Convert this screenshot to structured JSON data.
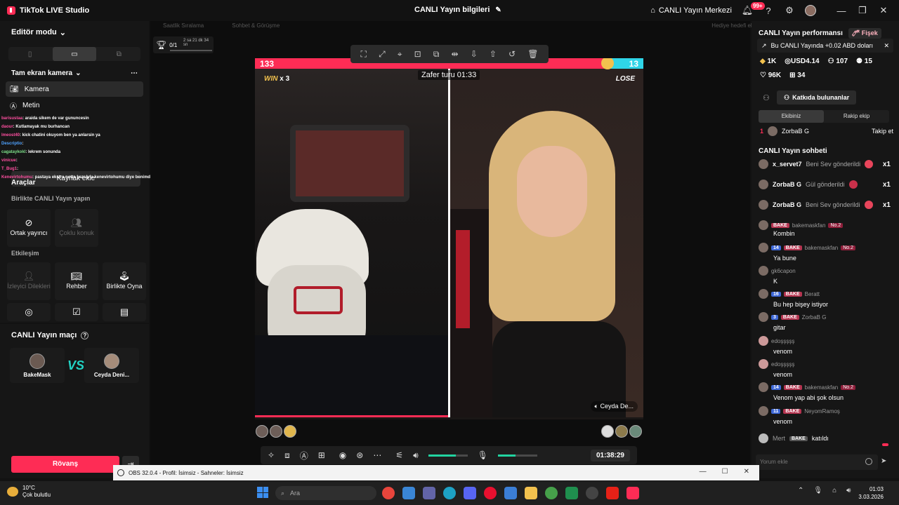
{
  "titlebar": {
    "app_name": "TikTok LIVE Studio",
    "center_title": "CANLI Yayın bilgileri",
    "center_merkez": "CANLI Yayın Merkezi",
    "notif_badge": "99+"
  },
  "left": {
    "editor_mode": "Editör modu",
    "scene_title": "Tam ekran kamera",
    "sources": [
      "Kamera",
      "Metin"
    ],
    "add_source": "Kaynak ekle",
    "tools": "Araçlar",
    "together_label": "Birlikte CANLI Yayın yapın",
    "together_tiles": [
      "Ortak yayıncı",
      "Çoklu konuk"
    ],
    "interaction_label": "Etkileşim",
    "interaction_tiles": [
      "İzleyici Dilekleri",
      "Rehber",
      "Birlikte Oyna"
    ],
    "match_title": "CANLI Yayın maçı",
    "match_player1": "BakeMask",
    "match_player2": "Ceyda Deni...",
    "vs": "VS",
    "rovans": "Rövanş",
    "overlay_chat": [
      {
        "name": "barisustaa",
        "text": ": araida sikem de var gununcesin"
      },
      {
        "name": "daour",
        "text": ": Kutlamayak mu burhancan"
      },
      {
        "name": "lmeost40",
        "text": ": kick chatini okuyom ben ya anlarsin ya"
      },
      {
        "name": "Descriptio",
        "text": ":"
      },
      {
        "name": "cagataykokl",
        "text": ": lekrem sonunda"
      },
      {
        "name": "vinicue",
        "text": ":"
      },
      {
        "name": "T_Bug1",
        "text": ":"
      },
      {
        "name": "Kenevirtohumu",
        "text": ": pastaya ekstra notta yazsana kenevirtohumu diye benimde doğum günüm"
      }
    ]
  },
  "center": {
    "top_strip": [
      "Saatlik Sıralama",
      "Sohbet & Görüşme",
      "Hediye hedefi ekle"
    ],
    "goal": {
      "count": "0/1",
      "time": "2 sa 21 dk 34 sn"
    },
    "score_left": "133",
    "score_right": "13",
    "timer": "Zafer turu 01:33",
    "win_label": "WIN",
    "win_count": "x 3",
    "lose_label": "LOSE",
    "right_name": "Ceyda De...",
    "elapsed": "01:38:29",
    "volume_level": 0.7,
    "mic_level": 0.45
  },
  "right": {
    "perf_title": "CANLI Yayın performansı",
    "fisek": "Fişek",
    "notice": "Bu CANLI Yayında +0.02 ABD doları",
    "stats1": [
      "1K",
      "USD4.14",
      "107",
      "15"
    ],
    "stats2": [
      "96K",
      "34"
    ],
    "contributors_btn": "Katkıda bulunanlar",
    "tab_ours": "Ekibiniz",
    "tab_rival": "Rakip ekip",
    "top_contrib": {
      "rank": "1",
      "name": "ZorbaB G",
      "follow": "Takip et"
    },
    "chat_title": "CANLI Yayın sohbeti",
    "gifts": [
      {
        "user": "x_servet7",
        "text": "Beni Sev gönderildi",
        "count": "x1"
      },
      {
        "user": "ZorbaB G",
        "text": "Gül gönderildi",
        "count": "x1"
      },
      {
        "user": "ZorbaB G",
        "text": "Beni Sev gönderildi",
        "count": "x1"
      }
    ],
    "messages": [
      {
        "lvl": "",
        "fan": "BAKE",
        "user": "bakemaskfan",
        "no": "No.2",
        "text": "Kombin"
      },
      {
        "lvl": "14",
        "fan": "BAKE",
        "user": "bakemaskfan",
        "no": "No.2",
        "text": "Ya bune"
      },
      {
        "lvl": "",
        "fan": "",
        "user": "gk6capon",
        "no": "",
        "text": "K"
      },
      {
        "lvl": "16",
        "fan": "BAKE",
        "user": "Beratt",
        "no": "",
        "text": "Bu hep bişey istiyor"
      },
      {
        "lvl": "3",
        "fan": "BAKE",
        "user": "ZorbaB G",
        "no": "",
        "text": "gitar"
      },
      {
        "lvl": "",
        "fan": "",
        "user": "edoşşşşş",
        "no": "",
        "text": "venom"
      },
      {
        "lvl": "",
        "fan": "",
        "user": "edoşşşşş",
        "no": "",
        "text": "venom"
      },
      {
        "lvl": "14",
        "fan": "BAKE",
        "user": "bakemaskfan",
        "no": "No.2",
        "text": "Venom yap abi şok olsun"
      },
      {
        "lvl": "11",
        "fan": "BAKE",
        "user": "NeyomRamoş",
        "no": "",
        "text": "venom"
      }
    ],
    "join": {
      "user": "Mert",
      "fan": "BAKE",
      "text": "katıldı"
    },
    "comment_placeholder": "Yorum ekle"
  },
  "obs": {
    "title": "OBS 32.0.4 - Profil: İsimsiz - Sahneler: İsimsiz"
  },
  "taskbar": {
    "temp": "10°C",
    "weather": "Çok bulutlu",
    "search": "Ara",
    "time": "01:03",
    "date": "3.03.2026"
  },
  "colors": {
    "accent": "#fe2c55",
    "rival": "#2fd5e8",
    "bg": "#121212"
  }
}
